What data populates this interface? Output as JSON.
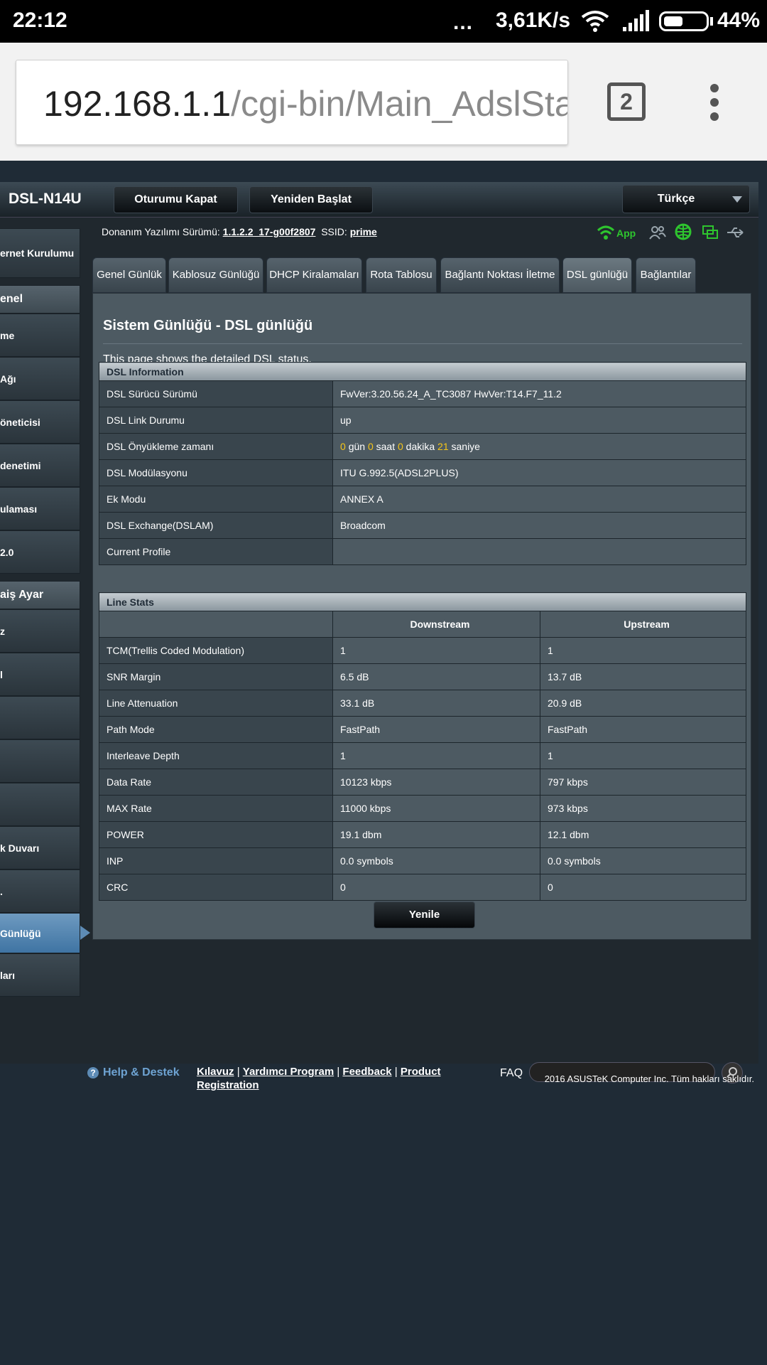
{
  "status_bar": {
    "time": "22:12",
    "dots": "...",
    "speed": "3,61K/s",
    "battery_pct": "44%",
    "battery_level": 0.44
  },
  "browser": {
    "url_host": "192.168.1.1",
    "url_path": "/cgi-bin/Main_AdslSta",
    "tab_count": "2"
  },
  "router": {
    "model": "DSL-N14U",
    "logout_label": "Oturumu Kapat",
    "reboot_label": "Yeniden Başlat",
    "language": "Türkçe",
    "fw_label": "Donanım Yazılımı Sürümü:",
    "fw_version": "1.1.2.2_17-g00f2807",
    "ssid_label": "SSID:",
    "ssid": "prime",
    "app_label": "App"
  },
  "sidebar": {
    "items": [
      {
        "label": "ernet Kurulumu"
      },
      {
        "label": "enel"
      },
      {
        "label": "me"
      },
      {
        "label": "Ağı"
      },
      {
        "label": "öneticisi"
      },
      {
        "label": " denetimi"
      },
      {
        "label": "ulaması"
      },
      {
        "label": " 2.0"
      },
      {
        "label": "aiş Ayar"
      },
      {
        "label": "z"
      },
      {
        "label": "l"
      },
      {
        "label": ""
      },
      {
        "label": ""
      },
      {
        "label": ""
      },
      {
        "label": "k Duvarı"
      },
      {
        "label": "."
      },
      {
        "label": "Günlüğü"
      },
      {
        "label": "ları"
      }
    ]
  },
  "tabs": [
    {
      "label": "Genel Günlük"
    },
    {
      "label": "Kablosuz Günlüğü"
    },
    {
      "label": "DHCP Kiralamaları"
    },
    {
      "label": "Rota Tablosu"
    },
    {
      "label": "Bağlantı Noktası İletme"
    },
    {
      "label": "DSL günlüğü"
    },
    {
      "label": "Bağlantılar"
    }
  ],
  "panel": {
    "title": "Sistem Günlüğü - DSL günlüğü",
    "description": "This page shows the detailed DSL status.",
    "refresh_label": "Yenile"
  },
  "dsl_info": {
    "header": "DSL Information",
    "driver_label": "DSL Sürücü Sürümü",
    "driver_value": "FwVer:3.20.56.24_A_TC3087 HwVer:T14.F7_11.2",
    "link_label": "DSL Link Durumu",
    "link_value": "up",
    "uptime_label": "DSL Önyükleme zamanı",
    "uptime_days": "0",
    "uptime_days_unit": "gün",
    "uptime_hours": "0",
    "uptime_hours_unit": "saat",
    "uptime_minutes": "0",
    "uptime_minutes_unit": "dakika",
    "uptime_seconds": "21",
    "uptime_seconds_unit": "saniye",
    "mod_label": "DSL Modülasyonu",
    "mod_value": "ITU G.992.5(ADSL2PLUS)",
    "annex_label": "Ek Modu",
    "annex_value": "ANNEX A",
    "dslam_label": "DSL Exchange(DSLAM)",
    "dslam_value": "Broadcom",
    "profile_label": "Current Profile",
    "profile_value": ""
  },
  "line_stats": {
    "header": "Line Stats",
    "downstream_label": "Downstream",
    "upstream_label": "Upstream",
    "rows": [
      {
        "label": "TCM(Trellis Coded Modulation)",
        "down": "1",
        "up": "1"
      },
      {
        "label": "SNR Margin",
        "down": "6.5 dB",
        "up": "13.7 dB"
      },
      {
        "label": "Line Attenuation",
        "down": "33.1 dB",
        "up": "20.9 dB"
      },
      {
        "label": "Path Mode",
        "down": "FastPath",
        "up": "FastPath"
      },
      {
        "label": "Interleave Depth",
        "down": "1",
        "up": "1"
      },
      {
        "label": "Data Rate",
        "down": "10123 kbps",
        "up": "797 kbps"
      },
      {
        "label": "MAX Rate",
        "down": "11000 kbps",
        "up": "973 kbps"
      },
      {
        "label": "POWER",
        "down": "19.1 dbm",
        "up": "12.1 dbm"
      },
      {
        "label": "INP",
        "down": "0.0 symbols",
        "up": "0.0 symbols"
      },
      {
        "label": "CRC",
        "down": "0",
        "up": "0"
      }
    ]
  },
  "footer": {
    "help_label": "Help & Destek",
    "link_manual": "Kılavuz",
    "link_utility": "Yardımcı Program",
    "link_feedback": "Feedback",
    "link_product": "Product",
    "link_registration": "Registration",
    "sep": "|",
    "faq_label": "FAQ",
    "copyright": "2016 ASUSTeK Computer Inc. Tüm hakları saklıdır."
  }
}
